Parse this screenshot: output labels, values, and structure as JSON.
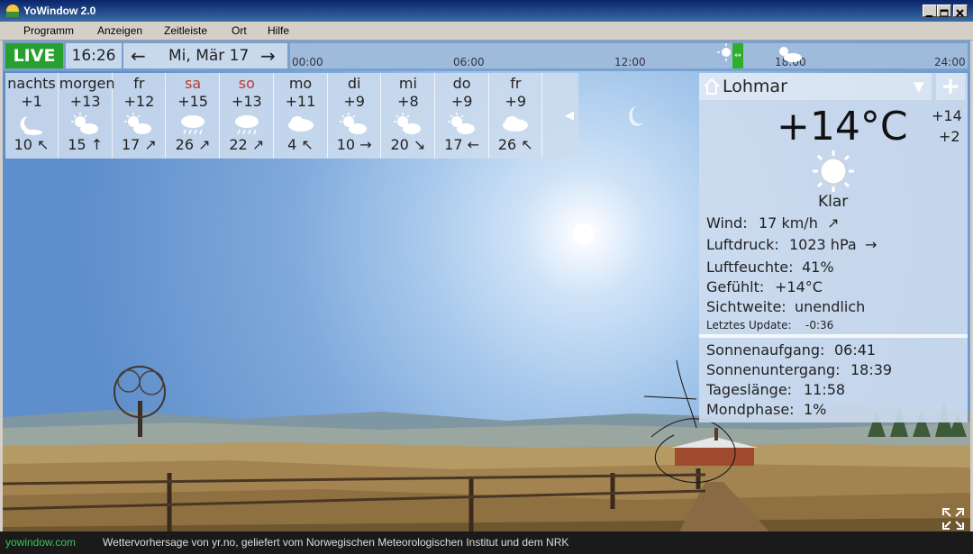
{
  "window": {
    "title": "YoWindow 2.0"
  },
  "menu": [
    "Programm",
    "Anzeigen",
    "Zeitleiste",
    "Ort",
    "Hilfe"
  ],
  "timeline": {
    "live_label": "LIVE",
    "time": "16:26",
    "date": "Mi, Mär 17",
    "ticks": [
      "00:00",
      "06:00",
      "12:00",
      "18:00",
      "24:00"
    ]
  },
  "forecast": [
    {
      "label": "nachts",
      "temp": "+1",
      "icon": "moon-icon",
      "wind": "10",
      "arrow": "↖",
      "weekend": false
    },
    {
      "label": "morgen",
      "temp": "+13",
      "icon": "sun-cloud-icon",
      "wind": "15",
      "arrow": "↑",
      "weekend": false
    },
    {
      "label": "fr",
      "temp": "+12",
      "icon": "sun-cloud-icon",
      "wind": "17",
      "arrow": "↗",
      "weekend": false
    },
    {
      "label": "sa",
      "temp": "+15",
      "icon": "rain-cloud-icon",
      "wind": "26",
      "arrow": "↗",
      "weekend": true
    },
    {
      "label": "so",
      "temp": "+13",
      "icon": "rain-cloud-icon",
      "wind": "22",
      "arrow": "↗",
      "weekend": true
    },
    {
      "label": "mo",
      "temp": "+11",
      "icon": "cloud-icon",
      "wind": "4",
      "arrow": "↖",
      "weekend": false
    },
    {
      "label": "di",
      "temp": "+9",
      "icon": "sun-cloud-icon",
      "wind": "10",
      "arrow": "→",
      "weekend": false
    },
    {
      "label": "mi",
      "temp": "+8",
      "icon": "sun-cloud-icon",
      "wind": "20",
      "arrow": "↘",
      "weekend": false
    },
    {
      "label": "do",
      "temp": "+9",
      "icon": "sun-cloud-icon",
      "wind": "17",
      "arrow": "←",
      "weekend": false
    },
    {
      "label": "fr",
      "temp": "+9",
      "icon": "cloud-icon",
      "wind": "26",
      "arrow": "↖",
      "weekend": false
    }
  ],
  "current": {
    "location": "Lohmar",
    "temp": "+14°C",
    "hi": "+14",
    "lo": "+2",
    "condition": "Klar",
    "wind_label": "Wind:",
    "wind_value": "17 km/h",
    "wind_arrow": "↗",
    "pressure_label": "Luftdruck:",
    "pressure_value": "1023 hPa",
    "pressure_arrow": "→",
    "humidity_label": "Luftfeuchte:",
    "humidity_value": "41%",
    "feels_label": "Gefühlt:",
    "feels_value": "+14°C",
    "visibility_label": "Sichtweite:",
    "visibility_value": "unendlich",
    "update_label": "Letztes Update:",
    "update_value": "-0:36"
  },
  "sun": {
    "sunrise_label": "Sonnenaufgang:",
    "sunrise_value": "06:41",
    "sunset_label": "Sonnenuntergang:",
    "sunset_value": "18:39",
    "daylength_label": "Tageslänge:",
    "daylength_value": "11:58",
    "moon_label": "Mondphase:",
    "moon_value": "1%"
  },
  "footer": {
    "source": "yowindow.com",
    "credit": "Wettervorhersage von yr.no, geliefert vom Norwegischen Meteorologischen Institut und dem NRK"
  },
  "colors": {
    "live": "#27a12e",
    "weekend": "#c0392b",
    "footer_link": "#39c65b"
  }
}
